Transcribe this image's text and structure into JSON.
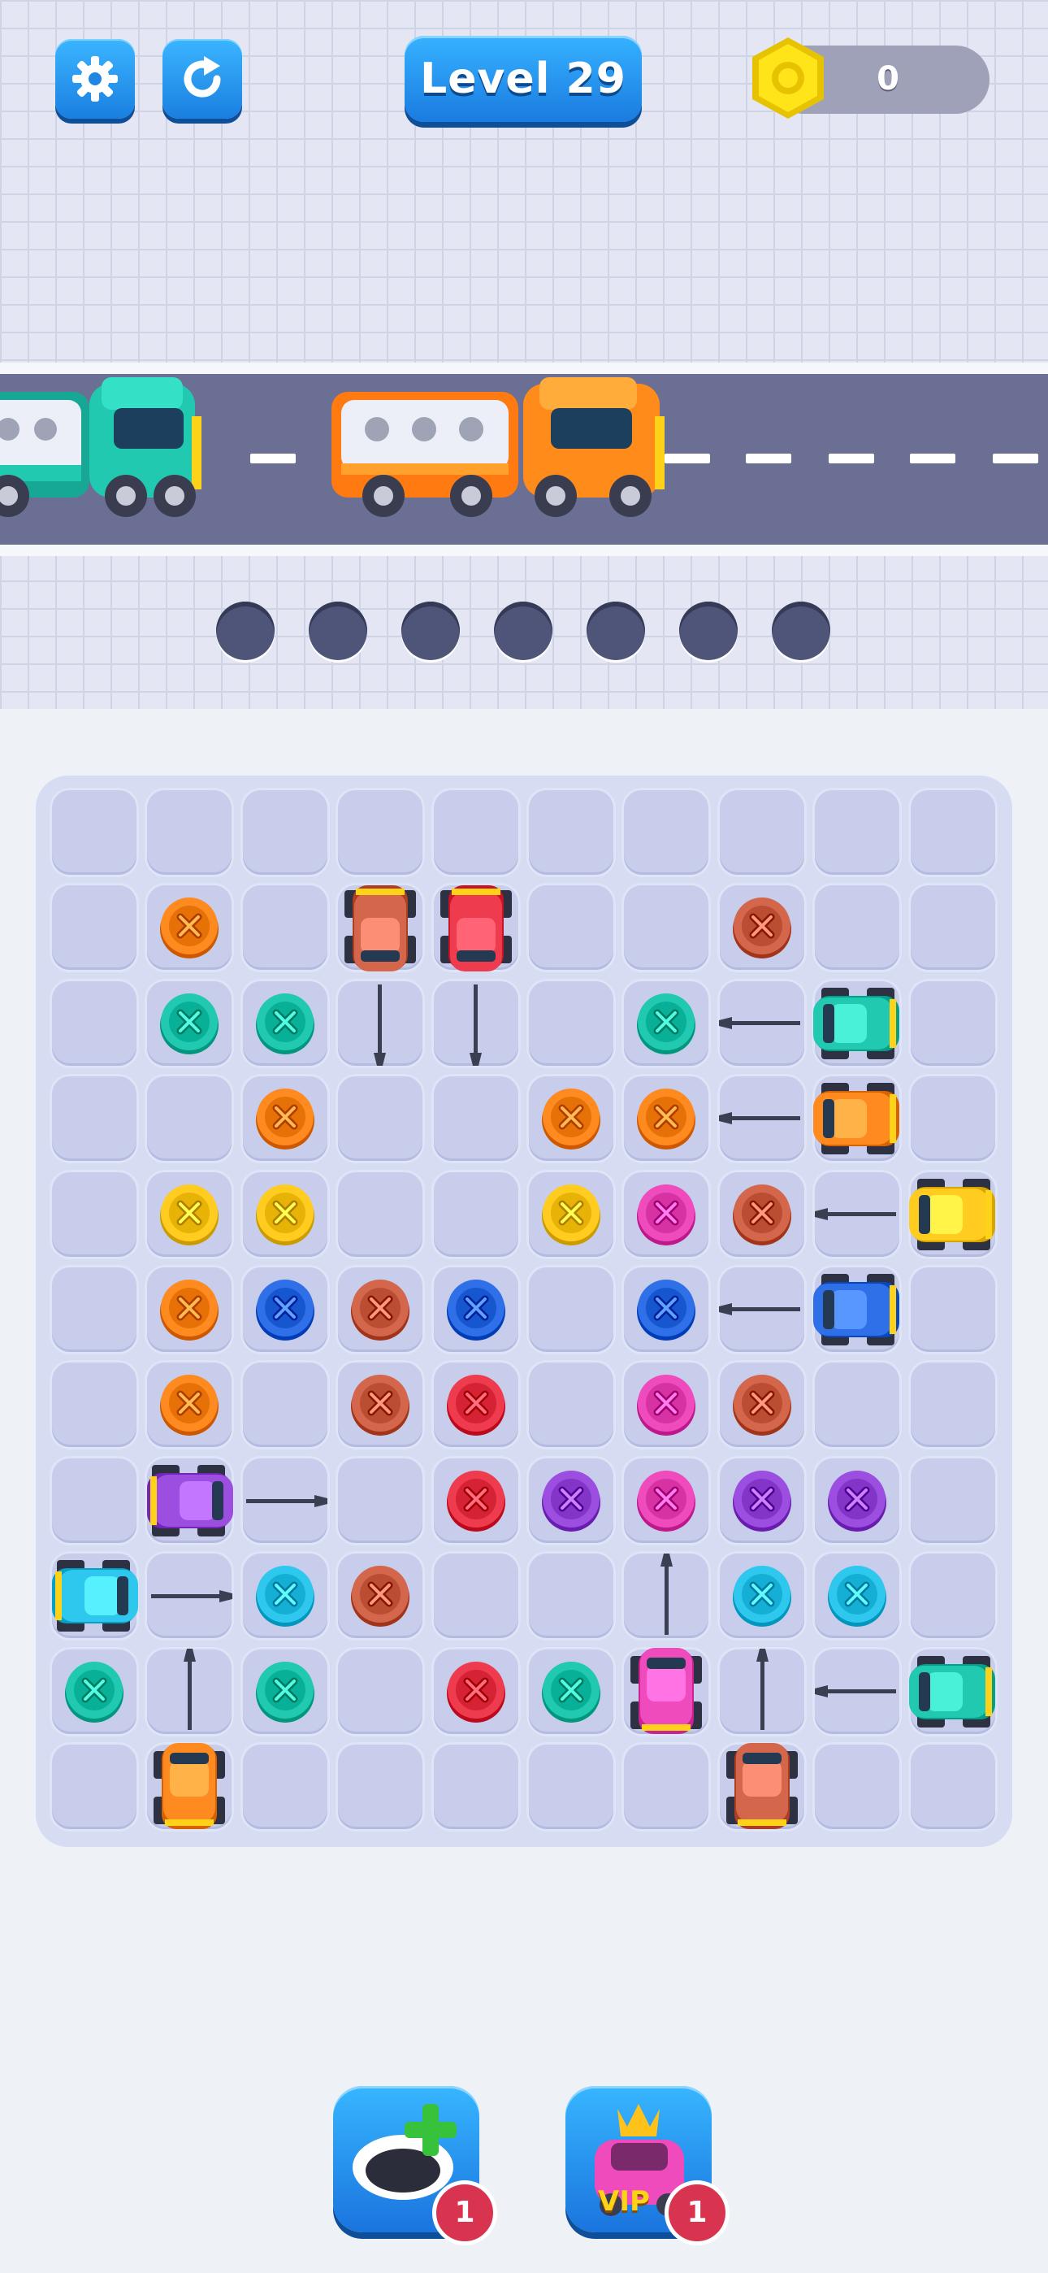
{
  "hud": {
    "settings_icon": "gear-icon",
    "restart_icon": "restart-icon",
    "level_label": "Level 29",
    "coins": "0",
    "coin_icon": "hex-nut-coin-icon"
  },
  "road": {
    "vehicles": [
      {
        "name": "teal bus",
        "color": "#1fc9b3"
      },
      {
        "name": "orange bus",
        "color": "#ff8c1a"
      }
    ],
    "waiting_slots": 7
  },
  "board": {
    "colors": {
      "orange": "#ff8a1f",
      "teal": "#20c9b0",
      "brown": "#d4664c",
      "red": "#ef3b4e",
      "yellow": "#ffcc1f",
      "blue": "#2f6fe8",
      "cyan": "#2ec8ef",
      "pink": "#ef4bbd",
      "purple": "#9b4ee0",
      "board_bg": "#d6dcf2",
      "cell_bg": "#c7cdeb"
    },
    "screws": [
      {
        "row": 1,
        "col": 1,
        "color": "orange"
      },
      {
        "row": 1,
        "col": 7,
        "color": "brown"
      },
      {
        "row": 2,
        "col": 1,
        "color": "teal"
      },
      {
        "row": 2,
        "col": 2,
        "color": "teal"
      },
      {
        "row": 2,
        "col": 6,
        "color": "teal"
      },
      {
        "row": 3,
        "col": 2,
        "color": "orange"
      },
      {
        "row": 3,
        "col": 5,
        "color": "orange"
      },
      {
        "row": 3,
        "col": 6,
        "color": "orange"
      },
      {
        "row": 4,
        "col": 1,
        "color": "yellow"
      },
      {
        "row": 4,
        "col": 2,
        "color": "yellow"
      },
      {
        "row": 4,
        "col": 5,
        "color": "yellow"
      },
      {
        "row": 4,
        "col": 6,
        "color": "pink"
      },
      {
        "row": 4,
        "col": 7,
        "color": "brown"
      },
      {
        "row": 5,
        "col": 1,
        "color": "orange"
      },
      {
        "row": 5,
        "col": 2,
        "color": "blue"
      },
      {
        "row": 5,
        "col": 3,
        "color": "brown"
      },
      {
        "row": 5,
        "col": 4,
        "color": "blue"
      },
      {
        "row": 5,
        "col": 6,
        "color": "blue"
      },
      {
        "row": 6,
        "col": 1,
        "color": "orange"
      },
      {
        "row": 6,
        "col": 3,
        "color": "brown"
      },
      {
        "row": 6,
        "col": 4,
        "color": "red"
      },
      {
        "row": 6,
        "col": 6,
        "color": "pink"
      },
      {
        "row": 6,
        "col": 7,
        "color": "brown"
      },
      {
        "row": 7,
        "col": 4,
        "color": "red"
      },
      {
        "row": 7,
        "col": 5,
        "color": "purple"
      },
      {
        "row": 7,
        "col": 6,
        "color": "pink"
      },
      {
        "row": 7,
        "col": 7,
        "color": "purple"
      },
      {
        "row": 7,
        "col": 8,
        "color": "purple"
      },
      {
        "row": 8,
        "col": 2,
        "color": "cyan"
      },
      {
        "row": 8,
        "col": 3,
        "color": "brown"
      },
      {
        "row": 8,
        "col": 7,
        "color": "cyan"
      },
      {
        "row": 8,
        "col": 8,
        "color": "cyan"
      },
      {
        "row": 9,
        "col": 0,
        "color": "teal"
      },
      {
        "row": 9,
        "col": 2,
        "color": "teal"
      },
      {
        "row": 9,
        "col": 4,
        "color": "red"
      },
      {
        "row": 9,
        "col": 5,
        "color": "teal"
      }
    ],
    "cars": [
      {
        "row": 1,
        "col": 3,
        "color": "brown",
        "dir": "down"
      },
      {
        "row": 1,
        "col": 4,
        "color": "red",
        "dir": "down"
      },
      {
        "row": 2,
        "col": 8,
        "color": "teal",
        "dir": "left"
      },
      {
        "row": 3,
        "col": 8,
        "color": "orange",
        "dir": "left"
      },
      {
        "row": 4,
        "col": 9,
        "color": "yellow",
        "dir": "left"
      },
      {
        "row": 5,
        "col": 8,
        "color": "blue",
        "dir": "left"
      },
      {
        "row": 7,
        "col": 1,
        "color": "purple",
        "dir": "right"
      },
      {
        "row": 8,
        "col": 0,
        "color": "cyan",
        "dir": "right"
      },
      {
        "row": 9,
        "col": 6,
        "color": "pink",
        "dir": "up"
      },
      {
        "row": 9,
        "col": 9,
        "color": "teal",
        "dir": "left"
      },
      {
        "row": 10,
        "col": 1,
        "color": "orange",
        "dir": "up"
      },
      {
        "row": 10,
        "col": 7,
        "color": "brown",
        "dir": "up"
      }
    ]
  },
  "boosters": [
    {
      "name": "add-slot",
      "icon": "add-hole-icon",
      "count": "1"
    },
    {
      "name": "vip",
      "icon": "vip-car-icon",
      "label": "VIP",
      "count": "1"
    }
  ]
}
